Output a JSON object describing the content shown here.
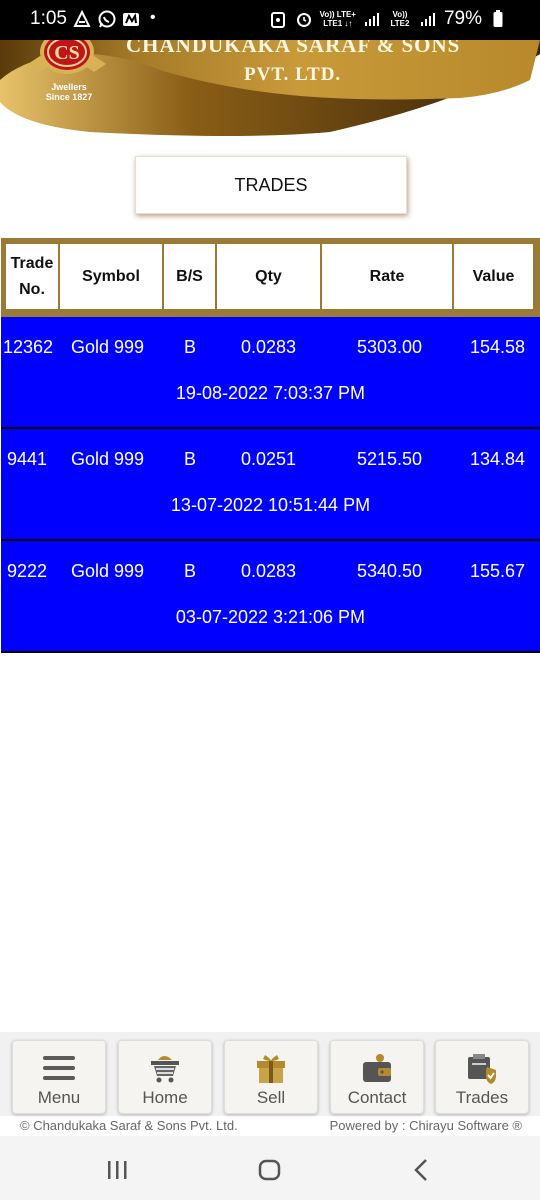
{
  "status_bar": {
    "time": "1:05",
    "dot": "•",
    "volte1": "Vo)) LTE+",
    "volte1b": "LTE1 ↓↑",
    "volte2": "Vo)) LTE2",
    "battery": "79%"
  },
  "header": {
    "logo_initials": "CS",
    "company_line1": "CHANDUKAKA SARAF & SONS",
    "company_line2": "PVT. LTD.",
    "logo_sub1": "Jwellers",
    "logo_sub2": "Since 1827",
    "colors": {
      "gold": "#b48a2c",
      "dark_gold": "#6b4a12",
      "red": "#c0141c"
    }
  },
  "page_title": "TRADES",
  "table": {
    "headers": {
      "trade_no_1": "Trade",
      "trade_no_2": "No.",
      "symbol": "Symbol",
      "bs": "B/S",
      "qty": "Qty",
      "rate": "Rate",
      "value": "Value"
    },
    "rows": [
      {
        "trade_no": "12362",
        "symbol": "Gold 999",
        "bs": "B",
        "qty": "0.0283",
        "rate": "5303.00",
        "value": "154.58",
        "datetime": "19-08-2022 7:03:37 PM"
      },
      {
        "trade_no": "9441",
        "symbol": "Gold 999",
        "bs": "B",
        "qty": "0.0251",
        "rate": "5215.50",
        "value": "134.84",
        "datetime": "13-07-2022 10:51:44 PM"
      },
      {
        "trade_no": "9222",
        "symbol": "Gold 999",
        "bs": "B",
        "qty": "0.0283",
        "rate": "5340.50",
        "value": "155.67",
        "datetime": "03-07-2022 3:21:06 PM"
      }
    ],
    "colors": {
      "header_border": "#9b7a35",
      "row_bg": "#0000ff"
    }
  },
  "bottom_nav": {
    "items": [
      {
        "label": "Menu",
        "icon": "hamburger-menu-icon"
      },
      {
        "label": "Home",
        "icon": "cart-icon"
      },
      {
        "label": "Sell",
        "icon": "gift-icon"
      },
      {
        "label": "Contact",
        "icon": "wallet-icon"
      },
      {
        "label": "Trades",
        "icon": "trades-box-icon"
      }
    ]
  },
  "footer": {
    "left": "© Chandukaka Saraf & Sons Pvt. Ltd.",
    "right": "Powered by : Chirayu Software ®"
  }
}
